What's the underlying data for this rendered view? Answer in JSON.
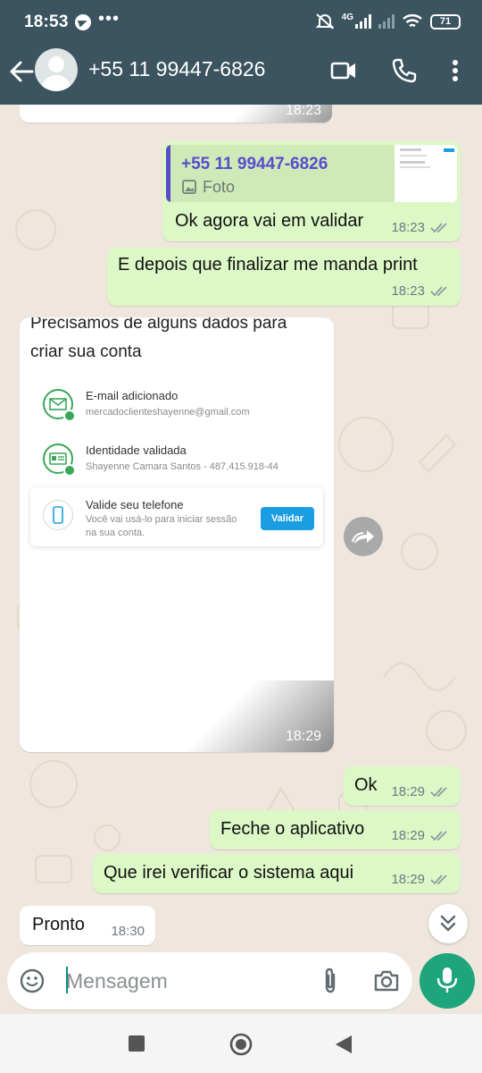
{
  "status_bar": {
    "time": "18:53",
    "network": "4G",
    "battery": "71"
  },
  "header": {
    "contact": "+55 11 99447-6826"
  },
  "messages": {
    "top_partial_time": "18:23",
    "quote": {
      "sender": "+55 11 99447-6826",
      "type": "Foto"
    },
    "m1": {
      "text": "Ok agora vai em validar",
      "time": "18:23"
    },
    "m2": {
      "text": "E depois que finalizar me manda print",
      "time": "18:23"
    },
    "m3": {
      "text": "Ok",
      "time": "18:29"
    },
    "m4": {
      "text": "Feche o aplicativo",
      "time": "18:29"
    },
    "m5": {
      "text": "Que irei verificar o sistema aqui",
      "time": "18:29"
    },
    "m6": {
      "text": "Pronto",
      "time": "18:30"
    }
  },
  "screenshot_msg": {
    "title_line1": "Precisamos de alguns dados para",
    "title_line2": "criar sua conta",
    "step1_label": "E-mail adicionado",
    "step1_sub": "mercadoclienteshayenne@gmail.com",
    "step2_label": "Identidade validada",
    "step2_sub": "Shayenne Camara Santos - 487.415.918-44",
    "step3_label": "Valide seu telefone",
    "step3_sub1": "Você vai usá-lo para iniciar sessão",
    "step3_sub2": "na sua conta.",
    "button": "Validar",
    "time": "18:29"
  },
  "composer": {
    "placeholder": "Mensagem"
  },
  "colors": {
    "header": "#3b545f",
    "outgoing": "#dcf8c6",
    "accent": "#1fa57c",
    "tick": "#8f9aa0"
  }
}
